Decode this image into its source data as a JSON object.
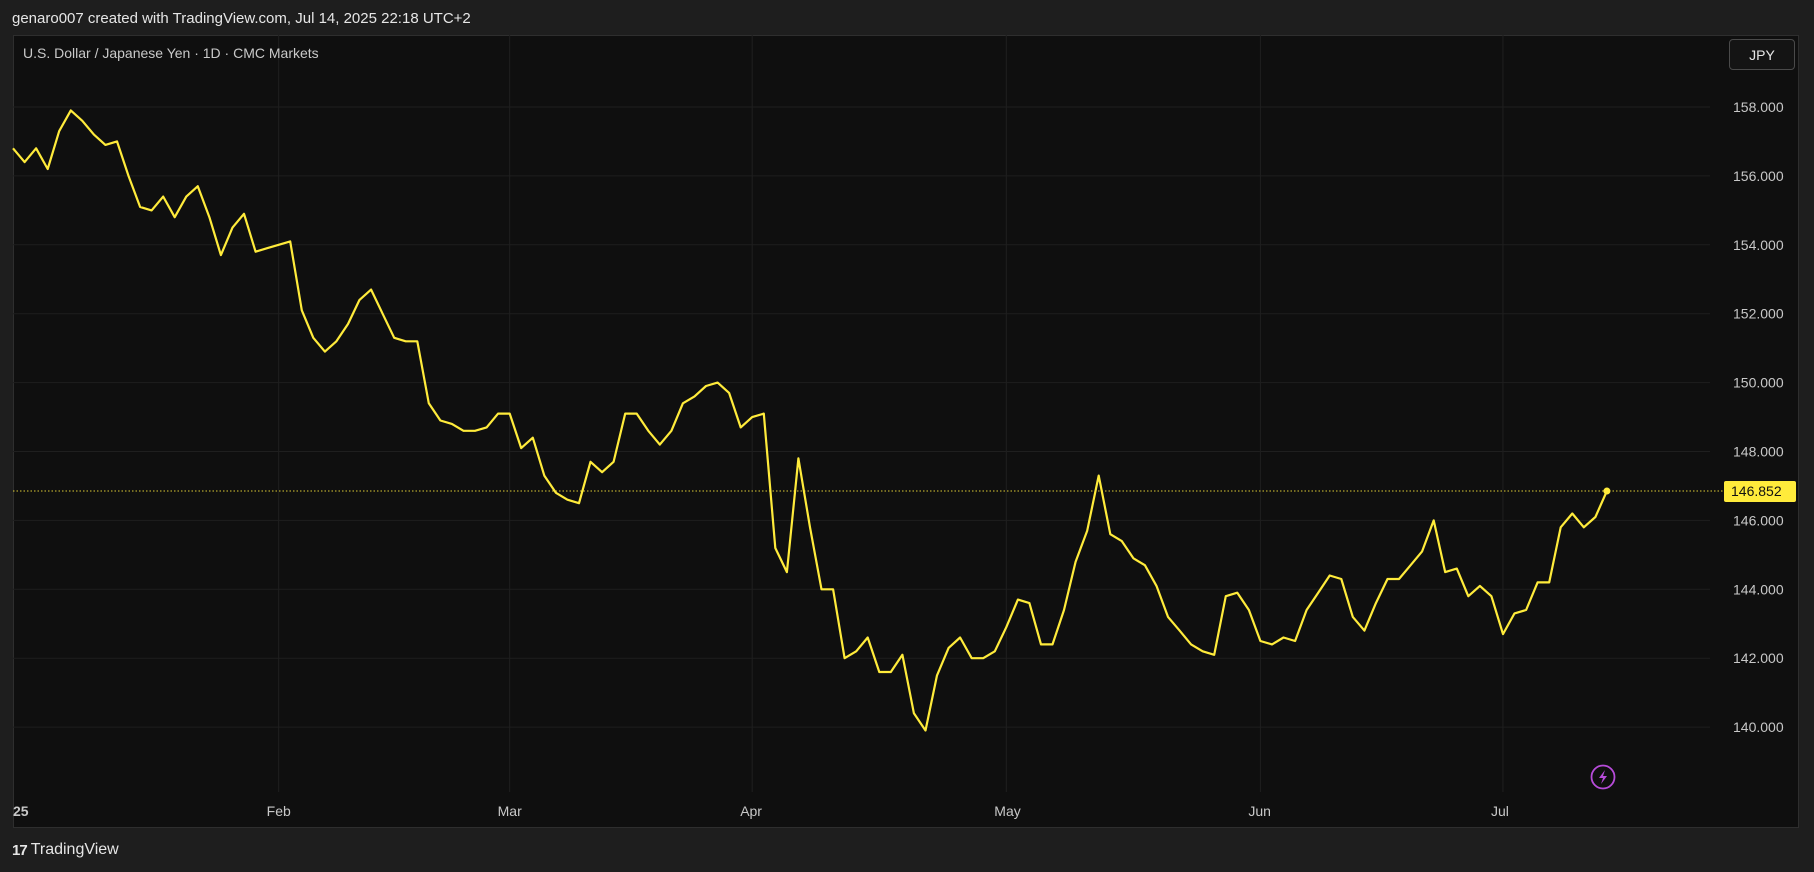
{
  "header": {
    "caption": "genaro007 created with TradingView.com, Jul 14, 2025 22:18 UTC+2"
  },
  "chart_title": "U.S. Dollar / Japanese Yen · 1D · CMC Markets",
  "currency_button": "JPY",
  "footer": {
    "brand_mark": "17",
    "brand_name": "TradingView"
  },
  "icons": {
    "lightning": "lightning-icon",
    "logo": "tradingview-logo-icon"
  },
  "colors": {
    "line": "#ffeb3b",
    "background": "#0f0f0f",
    "lightning": "#b74bd9"
  },
  "chart_data": {
    "type": "line",
    "title": "U.S. Dollar / Japanese Yen · 1D · CMC Markets",
    "xlabel": "",
    "ylabel": "",
    "ylim": [
      137.6,
      159.2
    ],
    "y_ticks": [
      140,
      142,
      144,
      146,
      148,
      150,
      152,
      154,
      156,
      158
    ],
    "y_tick_labels": [
      "140.000",
      "142.000",
      "144.000",
      "146.000",
      "148.000",
      "150.000",
      "152.000",
      "154.000",
      "156.000",
      "158.000"
    ],
    "x_tick_labels": [
      {
        "label": "25",
        "index": 0,
        "bold": true
      },
      {
        "label": "Feb",
        "index": 23
      },
      {
        "label": "Mar",
        "index": 43
      },
      {
        "label": "Apr",
        "index": 64
      },
      {
        "label": "May",
        "index": 86
      },
      {
        "label": "Jun",
        "index": 108
      },
      {
        "label": "Jul",
        "index": 129
      }
    ],
    "grid": true,
    "last_value": 146.852,
    "last_value_label": "146.852",
    "values": [
      156.8,
      156.4,
      156.8,
      156.2,
      157.3,
      157.9,
      157.6,
      157.2,
      156.9,
      157.0,
      156.0,
      155.1,
      155.0,
      155.4,
      154.8,
      155.4,
      155.7,
      154.8,
      153.7,
      154.5,
      154.9,
      153.8,
      153.9,
      154.0,
      154.1,
      152.1,
      151.3,
      150.9,
      151.2,
      151.7,
      152.4,
      152.7,
      152.0,
      151.3,
      151.2,
      151.2,
      149.4,
      148.9,
      148.8,
      148.6,
      148.6,
      148.7,
      149.1,
      149.1,
      148.1,
      148.4,
      147.3,
      146.8,
      146.6,
      146.5,
      147.7,
      147.4,
      147.7,
      149.1,
      149.1,
      148.6,
      148.2,
      148.6,
      149.4,
      149.6,
      149.9,
      150.0,
      149.7,
      148.7,
      149.0,
      149.1,
      145.2,
      144.5,
      147.8,
      145.8,
      144.0,
      144.0,
      142.0,
      142.2,
      142.6,
      141.6,
      141.6,
      142.1,
      140.4,
      139.9,
      141.5,
      142.3,
      142.6,
      142.0,
      142.0,
      142.2,
      142.9,
      143.7,
      143.6,
      142.4,
      142.4,
      143.4,
      144.8,
      145.7,
      147.3,
      145.6,
      145.4,
      144.9,
      144.7,
      144.1,
      143.2,
      142.8,
      142.4,
      142.2,
      142.1,
      143.8,
      143.9,
      143.4,
      142.5,
      142.4,
      142.6,
      142.5,
      143.4,
      143.9,
      144.4,
      144.3,
      143.2,
      142.8,
      143.6,
      144.3,
      144.3,
      144.7,
      145.1,
      146.0,
      144.5,
      144.6,
      143.8,
      144.1,
      143.8,
      142.7,
      143.3,
      143.4,
      144.2,
      144.2,
      145.8,
      146.2,
      145.8,
      146.1,
      146.852
    ]
  }
}
